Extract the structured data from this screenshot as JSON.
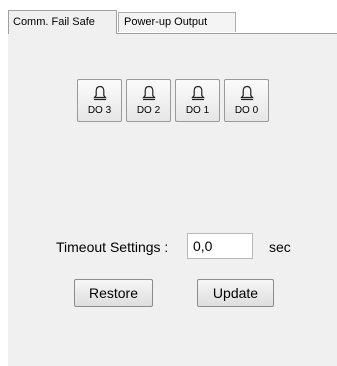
{
  "tabs": [
    {
      "label": "Comm. Fail Safe"
    },
    {
      "label": "Power-up Output"
    }
  ],
  "do_buttons": [
    {
      "label": "DO 3",
      "icon": "bell-icon"
    },
    {
      "label": "DO 2",
      "icon": "bell-icon"
    },
    {
      "label": "DO 1",
      "icon": "bell-icon"
    },
    {
      "label": "DO 0",
      "icon": "bell-icon"
    }
  ],
  "timeout": {
    "label": "Timeout Settings :",
    "value": "0,0",
    "unit": "sec"
  },
  "actions": {
    "restore_label": "Restore",
    "update_label": "Update"
  }
}
